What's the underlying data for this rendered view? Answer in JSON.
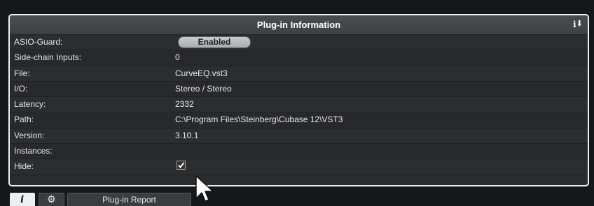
{
  "panel": {
    "title": "Plug-in Information",
    "rows": [
      {
        "label": "ASIO-Guard:",
        "value": "Enabled",
        "kind": "button"
      },
      {
        "label": "Side-chain Inputs:",
        "value": "0"
      },
      {
        "label": "File:",
        "value": "CurveEQ.vst3"
      },
      {
        "label": "I/O:",
        "value": "Stereo / Stereo"
      },
      {
        "label": "Latency:",
        "value": "2332"
      },
      {
        "label": "Path:",
        "value": "C:\\Program Files\\Steinberg\\Cubase 12\\VST3"
      },
      {
        "label": "Version:",
        "value": "3.10.1"
      },
      {
        "label": "Instances:",
        "value": ""
      },
      {
        "label": "Hide:",
        "value": "",
        "kind": "checkbox",
        "checked": true
      }
    ]
  },
  "toolbar": {
    "info_icon": "i",
    "gear_icon": "gear-icon",
    "report_label": "Plug-in Report"
  },
  "icons": {
    "header_info": "info-download-icon"
  }
}
